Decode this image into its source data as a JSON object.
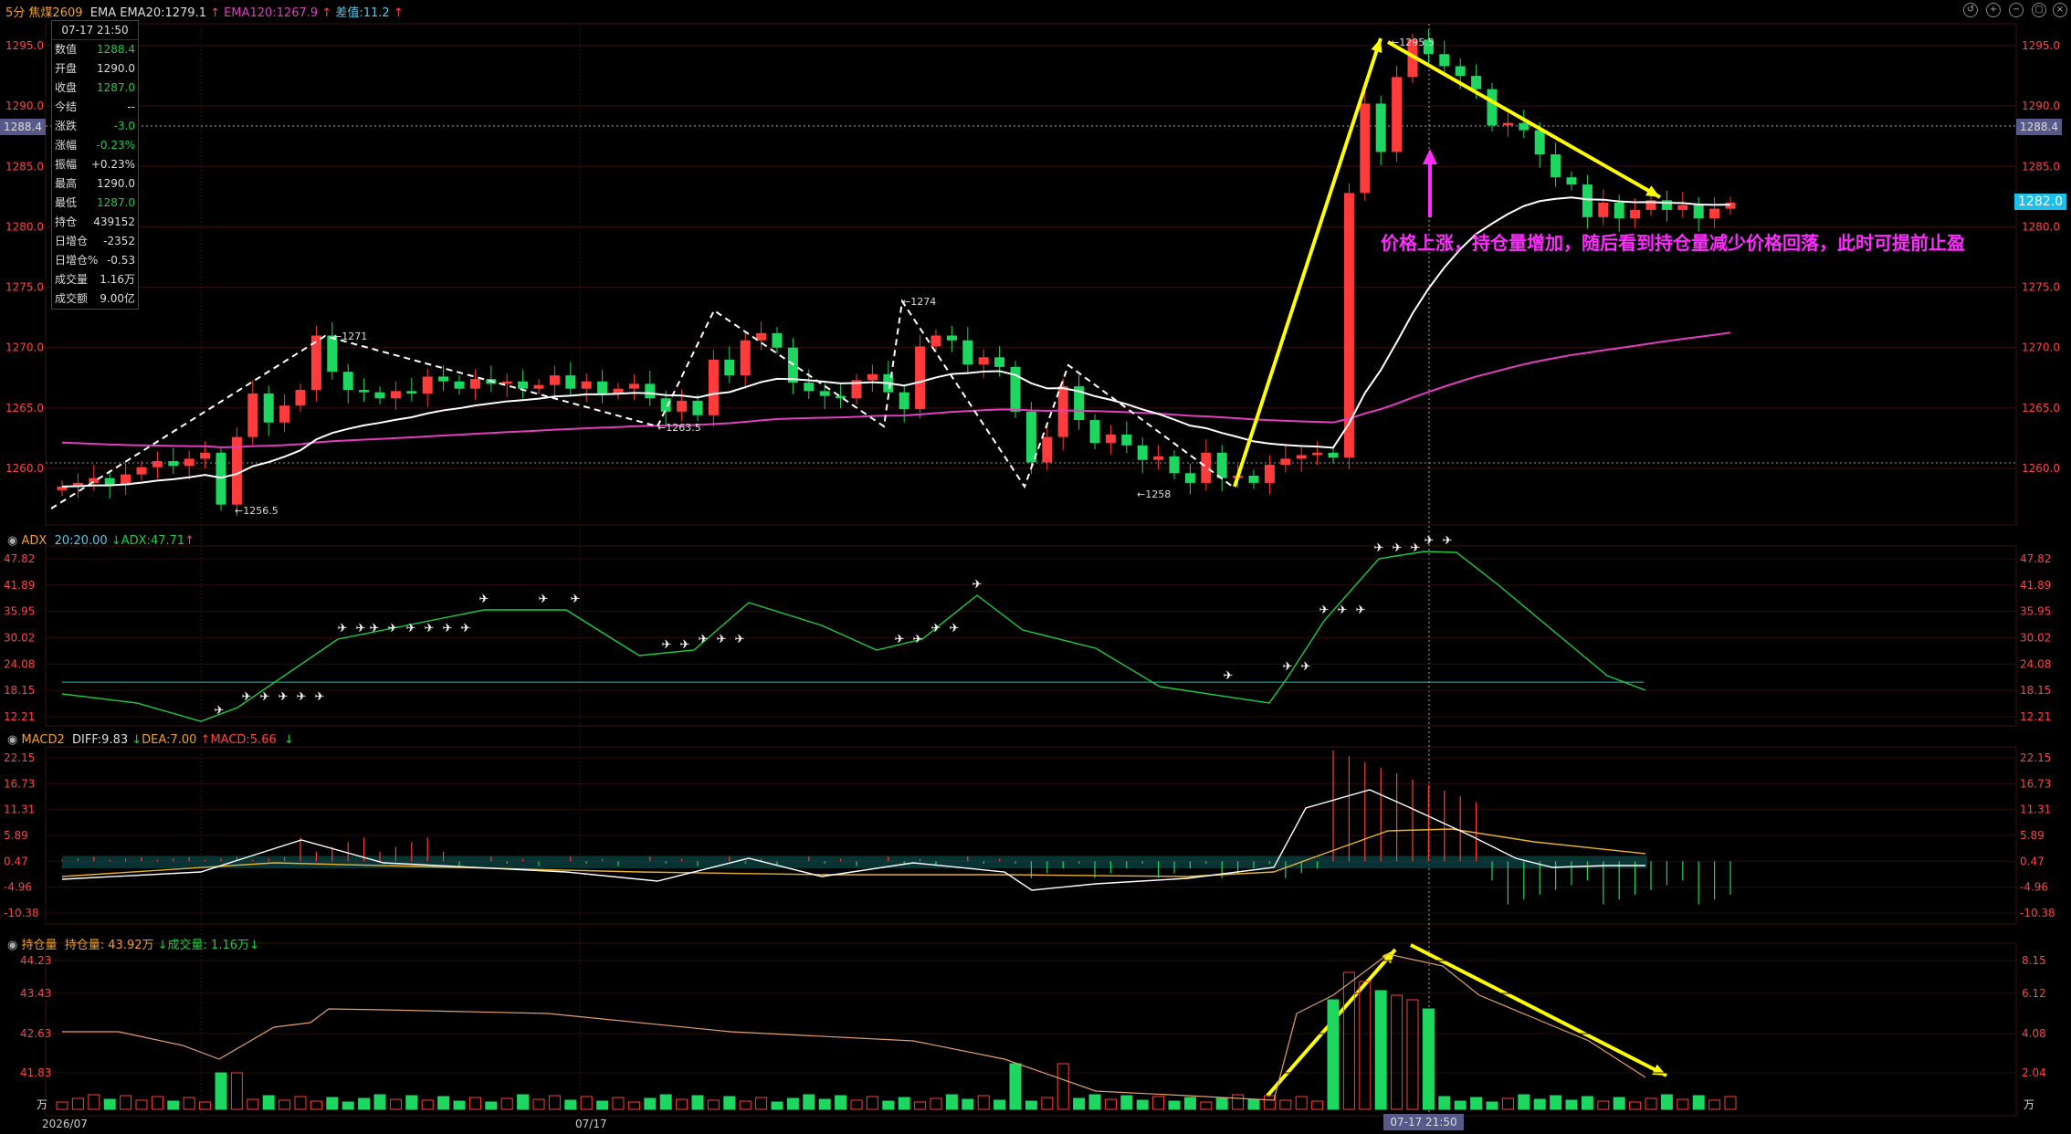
{
  "header": {
    "period": "5分",
    "symbol": "焦煤2609",
    "ema_label": "EMA",
    "ema20": "EMA20:1279.1",
    "ema120": "EMA120:1267.9",
    "diff": "差值:11.2"
  },
  "info_panel": {
    "timestamp": "07-17 21:50",
    "rows": [
      {
        "k": "数值",
        "v": "1288.4",
        "c": "dn"
      },
      {
        "k": "开盘",
        "v": "1290.0",
        "c": "wh"
      },
      {
        "k": "收盘",
        "v": "1287.0",
        "c": "dn"
      },
      {
        "k": "今结",
        "v": "--",
        "c": "wh"
      },
      {
        "k": "涨跌",
        "v": "-3.0",
        "c": "dn"
      },
      {
        "k": "涨幅",
        "v": "-0.23%",
        "c": "dn"
      },
      {
        "k": "振幅",
        "v": "+0.23%",
        "c": "wh"
      },
      {
        "k": "最高",
        "v": "1290.0",
        "c": "wh"
      },
      {
        "k": "最低",
        "v": "1287.0",
        "c": "dn"
      },
      {
        "k": "持仓",
        "v": "439152",
        "c": "wh"
      },
      {
        "k": "日增仓",
        "v": "-2352",
        "c": "wh"
      },
      {
        "k": "日增仓%",
        "v": "-0.53",
        "c": "wh"
      },
      {
        "k": "成交量",
        "v": "1.16万",
        "c": "wh"
      },
      {
        "k": "成交额",
        "v": "9.00亿",
        "c": "wh"
      }
    ]
  },
  "price_axis": {
    "ticks": [
      "1295.0",
      "1290.0",
      "1285.0",
      "1280.0",
      "1275.0",
      "1270.0",
      "1265.0",
      "1260.0"
    ],
    "current": "1282.0",
    "cursor": "1288.4"
  },
  "price_labels": {
    "high": "1295.5",
    "l1": "1256.5",
    "l2": "1271",
    "l3": "1263.5",
    "l4": "1274",
    "l5": "1258"
  },
  "annotation": "价格上涨，持仓量增加，随后看到持仓量减少价格回落，此时可提前止盈",
  "adx": {
    "name": "ADX",
    "params": "20:20.00",
    "value": "ADX:47.71",
    "ticks": [
      "47.82",
      "41.89",
      "35.95",
      "30.02",
      "24.08",
      "18.15",
      "12.21"
    ]
  },
  "macd": {
    "name": "MACD2",
    "diff": "DIFF:9.83",
    "dea": "DEA:7.00",
    "macd": "MACD:5.66",
    "ticks": [
      "22.15",
      "16.73",
      "11.31",
      "5.89",
      "0.47",
      "-4.96",
      "-10.38"
    ]
  },
  "oi": {
    "name": "持仓量",
    "oi_value": "持仓量: 43.92万",
    "vol_value": "成交量: 1.16万",
    "ticks_left": [
      "44.23",
      "43.43",
      "42.63",
      "41.83"
    ],
    "ticks_right": [
      "8.15",
      "6.12",
      "4.08",
      "2.04"
    ],
    "unit": "万"
  },
  "time_axis": {
    "start": "2026/07",
    "mid": "07/17",
    "cursor": "07-17 21:50"
  },
  "colors": {
    "up": "#ff3b3b",
    "down": "#1ed760",
    "ema20": "#ffffff",
    "ema120": "#e040c0",
    "annot": "#ff2bff",
    "arrow": "#ffff00"
  },
  "chart_data": {
    "type": "candlestick",
    "closes": [
      1258.5,
      1258.8,
      1259.2,
      1258.6,
      1259.5,
      1260.1,
      1260.6,
      1260.2,
      1260.8,
      1261.3,
      1257.0,
      1262.6,
      1266.2,
      1263.8,
      1265.2,
      1266.5,
      1271.0,
      1268.0,
      1266.5,
      1266.3,
      1265.8,
      1266.4,
      1266.2,
      1267.6,
      1267.2,
      1266.6,
      1267.4,
      1267.0,
      1267.2,
      1266.6,
      1266.9,
      1267.7,
      1266.6,
      1267.2,
      1266.2,
      1266.6,
      1267.0,
      1265.8,
      1264.7,
      1265.6,
      1264.4,
      1269.0,
      1267.7,
      1270.6,
      1271.2,
      1270.0,
      1267.1,
      1266.4,
      1266.0,
      1265.8,
      1267.3,
      1267.8,
      1266.3,
      1264.9,
      1270.1,
      1271.0,
      1270.6,
      1268.6,
      1269.2,
      1268.4,
      1264.7,
      1260.5,
      1262.6,
      1266.8,
      1264.0,
      1262.1,
      1262.8,
      1261.9,
      1260.7,
      1261.0,
      1259.6,
      1258.8,
      1261.3,
      1259.2,
      1259.4,
      1258.8,
      1260.3,
      1260.8,
      1261.1,
      1261.3,
      1260.9,
      1282.8,
      1290.2,
      1286.2,
      1292.4,
      1295.5,
      1294.3,
      1293.3,
      1292.5,
      1291.4,
      1288.4,
      1288.6,
      1288.0,
      1286.0,
      1284.1,
      1283.5,
      1280.8,
      1282.0,
      1280.7,
      1281.4,
      1282.2,
      1281.4,
      1281.8,
      1280.7,
      1281.5,
      1282.0
    ]
  }
}
